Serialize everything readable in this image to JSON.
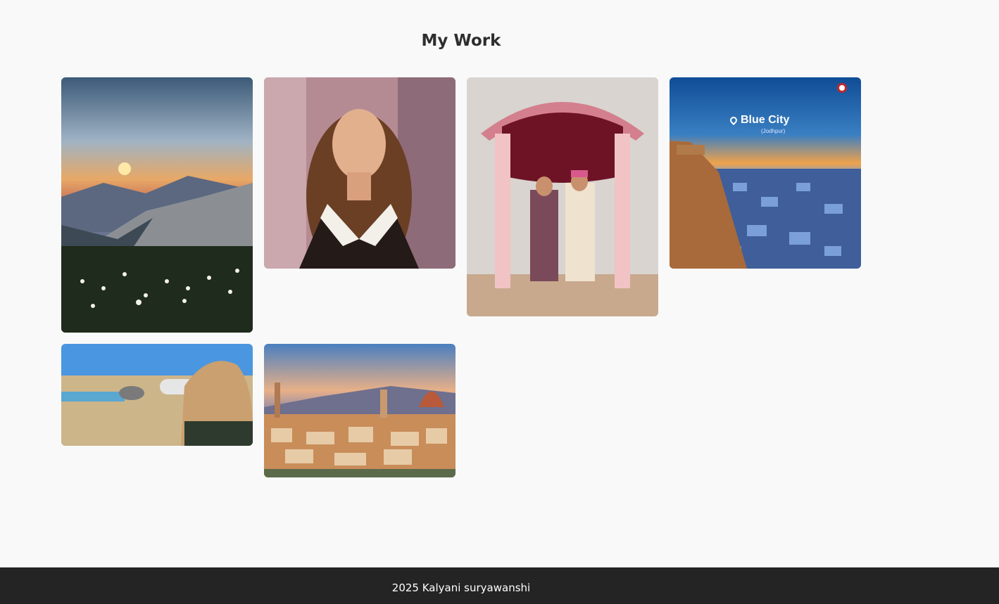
{
  "section": {
    "title": "My Work"
  },
  "gallery": [
    {
      "subject": "mountain-sunset-flowers"
    },
    {
      "subject": "portrait-woman"
    },
    {
      "subject": "wedding-mandap"
    },
    {
      "subject": "blue-city",
      "overlay_title": "Blue City",
      "overlay_subtitle": "(Jodhpur)"
    },
    {
      "subject": "wildlife-photographer"
    },
    {
      "subject": "florence-skyline"
    }
  ],
  "footer": {
    "text": "2025 Kalyani suryawanshi"
  }
}
